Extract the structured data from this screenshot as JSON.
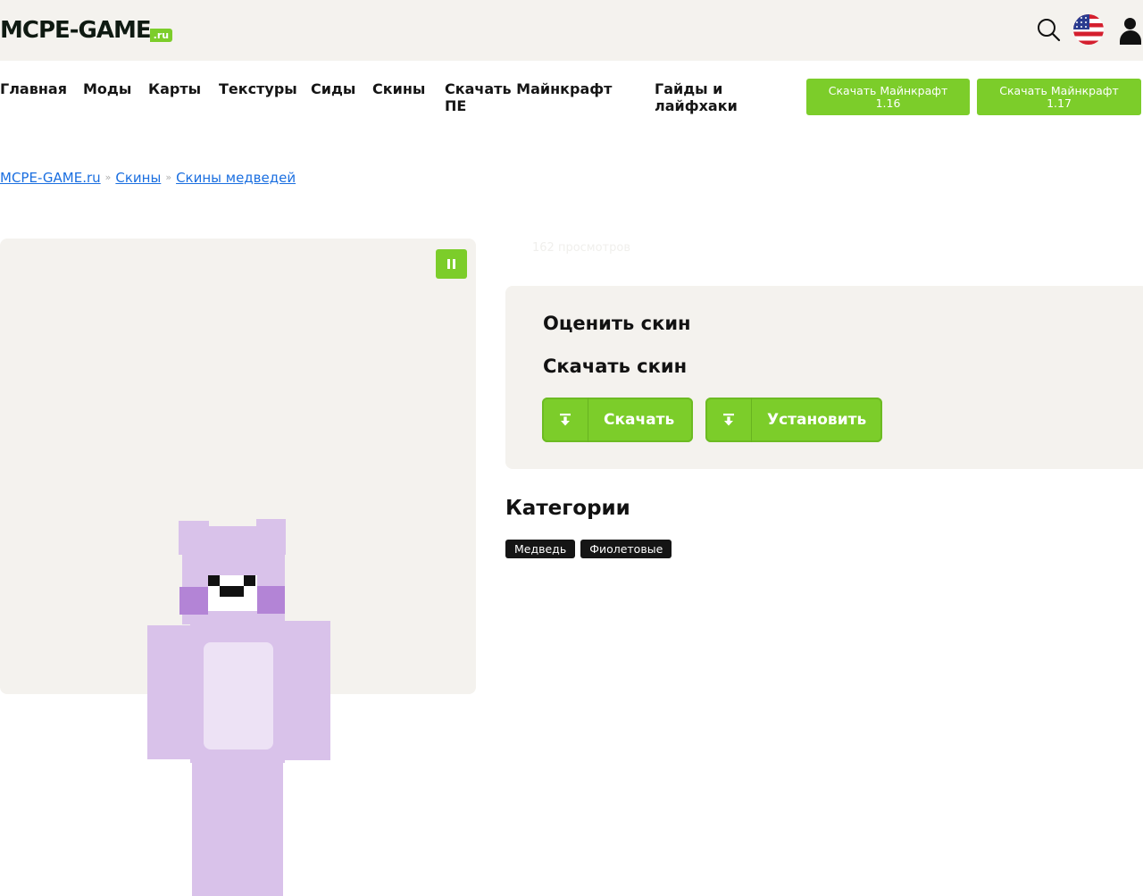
{
  "logo": {
    "main": "MCPE-GAME",
    "suffix": ".ru"
  },
  "header_icons": [
    "search-icon",
    "us-flag-icon",
    "user-icon"
  ],
  "nav": {
    "items": [
      "Главная",
      "Моды",
      "Карты",
      "Текстуры",
      "Сиды",
      "Скины",
      "Скачать Майнкрафт ПЕ",
      "Гайды и лайфхаки"
    ],
    "buttons": [
      {
        "line1": "Скачать Майнкрафт",
        "line2": "1.16"
      },
      {
        "line1": "Скачать Майнкрафт",
        "line2": "1.17"
      }
    ]
  },
  "breadcrumb": {
    "items": [
      "MCPE-GAME.ru",
      "Скины",
      "Скины медведей"
    ],
    "separator": "»"
  },
  "skin": {
    "views": "162 просмотров",
    "pause_icon": "pause-icon"
  },
  "panel": {
    "rate_title": "Оценить скин",
    "download_title": "Скачать скин",
    "download_button": "Скачать",
    "install_button": "Установить",
    "button_icon": "download-icon"
  },
  "categories": {
    "title": "Категории",
    "tags": [
      "Медведь",
      "Фиолетовые"
    ]
  },
  "colors": {
    "accent": "#7ccd2a",
    "link": "#1b6fe0",
    "panel_bg": "#f4f2ee",
    "skin_main": "#d9c2ea",
    "skin_belly": "#ede2f5",
    "skin_cheek": "#b384d6"
  }
}
